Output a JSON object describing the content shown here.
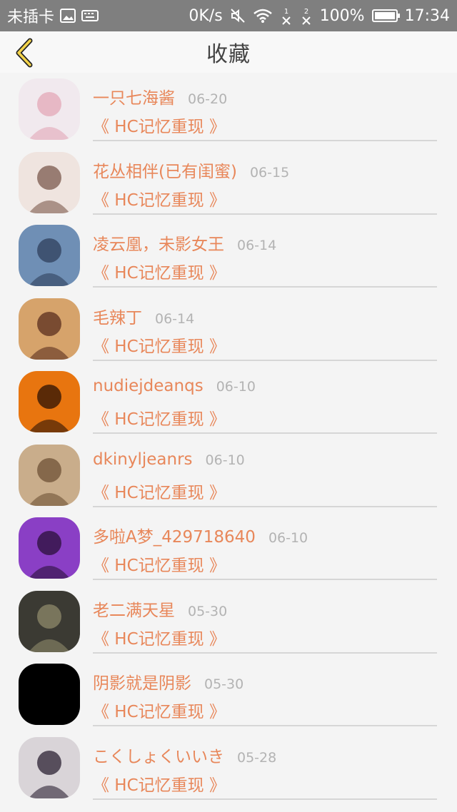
{
  "status_bar": {
    "carrier": "未插卡",
    "speed": "0K/s",
    "sim1": "1",
    "sim2": "2",
    "battery": "100%",
    "time": "17:34"
  },
  "header": {
    "back_icon": "chevron-left-icon",
    "title": "收藏"
  },
  "favorites": [
    {
      "name": "一只七海酱",
      "date": "06-20",
      "work": "《 HC记忆重现 》",
      "avatar_color": "#f1e9ee",
      "avatar_accent": "#e3a7b7"
    },
    {
      "name": "花丛相伴(已有闺蜜)",
      "date": "06-15",
      "work": "《 HC记忆重现 》",
      "avatar_color": "#efe4df",
      "avatar_accent": "#7b5a4d"
    },
    {
      "name": "凌云凰，未影女王",
      "date": "06-14",
      "work": "《 HC记忆重现 》",
      "avatar_color": "#6f8fb5",
      "avatar_accent": "#2f3f5c"
    },
    {
      "name": "毛辣丁",
      "date": "06-14",
      "work": "《 HC记忆重现 》",
      "avatar_color": "#d6a36b",
      "avatar_accent": "#5a2e1e"
    },
    {
      "name": "nudiejdeanqs",
      "date": "06-10",
      "work": "《 HC记忆重现 》",
      "avatar_color": "#e8750f",
      "avatar_accent": "#2b1205"
    },
    {
      "name": "dkinyljeanrs",
      "date": "06-10",
      "work": "《 HC记忆重现 》",
      "avatar_color": "#c9ad8b",
      "avatar_accent": "#6e5236"
    },
    {
      "name": "多啦A梦_429718640",
      "date": "06-10",
      "work": "《 HC记忆重现 》",
      "avatar_color": "#8a3fc5",
      "avatar_accent": "#2a1038"
    },
    {
      "name": "老二满天星",
      "date": "05-30",
      "work": "《 HC记忆重现 》",
      "avatar_color": "#3b3a33",
      "avatar_accent": "#8f8a6b"
    },
    {
      "name": "阴影就是阴影",
      "date": "05-30",
      "work": "《 HC记忆重现 》",
      "avatar_color": "#000000",
      "avatar_accent": "#000000"
    },
    {
      "name": "こくしょくいいき",
      "date": "05-28",
      "work": "《 HC记忆重现 》",
      "avatar_color": "#d9d4d8",
      "avatar_accent": "#2b2233"
    }
  ]
}
